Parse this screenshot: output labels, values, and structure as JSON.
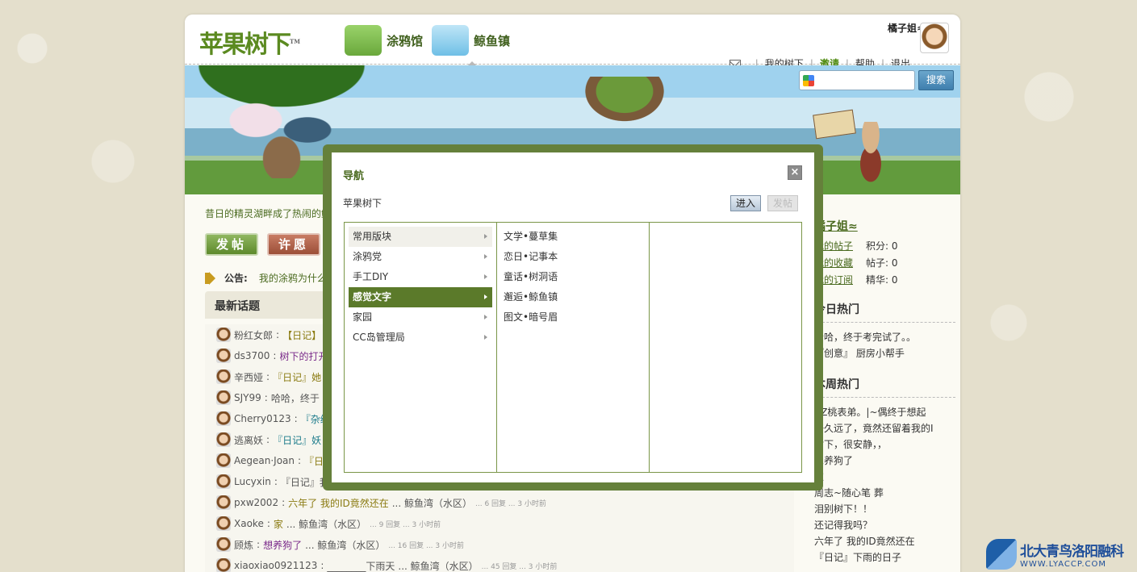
{
  "header": {
    "logo": "苹果树下",
    "logo_tm": "TM",
    "tabs": [
      {
        "label": "涂鸦馆"
      },
      {
        "label": "鲸鱼镇"
      }
    ],
    "username": "橘子姐≈",
    "links": {
      "my_tree": "我的树下",
      "invite": "邀请",
      "help": "帮助",
      "logout": "退出"
    }
  },
  "search": {
    "button": "搜索",
    "placeholder": ""
  },
  "main": {
    "marquee": "昔日的精灵湖畔成了热闹的鲸",
    "buttons": {
      "post": "发帖",
      "wish": "许愿"
    },
    "notice_label": "公告:",
    "notice_text": "我的涂鸦为什么",
    "latest_title": "最新话题",
    "topics": [
      {
        "user": "粉红女郎",
        "title": "【日记】",
        "style": "gold",
        "meta": "",
        "small": ""
      },
      {
        "user": "ds3700",
        "title": "树下的打开",
        "style": "purple",
        "meta": "",
        "small": ""
      },
      {
        "user": "辛西娅",
        "title": "『日记』她",
        "style": "gold",
        "meta": "",
        "small": ""
      },
      {
        "user": "SJY99",
        "title": "哈哈，终于",
        "style": "plain",
        "meta": "",
        "small": ""
      },
      {
        "user": "Cherry0123",
        "title": "『杂续",
        "style": "teal",
        "meta": "",
        "small": ""
      },
      {
        "user": "逃离妖",
        "title": "『日记』妖",
        "style": "teal",
        "meta": "",
        "small": ""
      },
      {
        "user": "Aegean·Joan",
        "title": "『日",
        "style": "gold",
        "meta": "",
        "small": ""
      },
      {
        "user": "Lucyxin",
        "title": "『日记』我",
        "style": "plain",
        "meta": "",
        "small": ""
      },
      {
        "user": "pxw2002",
        "title": "六年了 我的ID竟然还在",
        "style": "gold",
        "meta": "... 鲸鱼湾（水区）",
        "small": "... 6 回复 ... 3 小时前"
      },
      {
        "user": "Xaoke",
        "title": "家",
        "style": "gold",
        "meta": "... 鲸鱼湾（水区）",
        "small": "... 9 回复 ... 3 小时前"
      },
      {
        "user": "顾炼",
        "title": "想养狗了",
        "style": "purple",
        "meta": "... 鲸鱼湾（水区）",
        "small": "... 16 回复 ... 3 小时前"
      },
      {
        "user": "xiaoxiao0921123",
        "title": "________下雨天",
        "style": "plain",
        "meta": "... 鲸鱼湾（水区）",
        "small": "... 45 回复 ... 3 小时前"
      }
    ]
  },
  "sidebar": {
    "user": "橘子姐≈",
    "stats": [
      {
        "link": "我的帖子",
        "label": "积分: 0"
      },
      {
        "link": "我的收藏",
        "label": "帖子: 0"
      },
      {
        "link": "我的订阅",
        "label": "精华: 0"
      }
    ],
    "today_title": "今日热门",
    "today": [
      "哈哈，终于考完试了。。",
      "『创意』 厨房小帮手"
    ],
    "week_title": "本周热门",
    "week": [
      "AZ桃表弟。|~偶终于想起",
      "好久远了，竟然还留着我的I",
      "树下，很安静，，",
      "想养狗了",
      "家",
      "周志~随心笔 葬",
      "泪别树下！！",
      "还记得我吗？",
      "六年了 我的ID竟然还在",
      "『日记』下雨的日子"
    ]
  },
  "modal": {
    "title": "导航",
    "close": "×",
    "breadcrumb": "苹果树下",
    "enter": "进入",
    "post": "发帖",
    "categories": [
      {
        "label": "常用版块"
      },
      {
        "label": "涂鸦党"
      },
      {
        "label": "手工DIY"
      },
      {
        "label": "感觉文字"
      },
      {
        "label": "家园"
      },
      {
        "label": "CC岛管理局"
      }
    ],
    "subforums": [
      "文学•蔓草集",
      "恋日•记事本",
      "童话•树洞语",
      "邂逅•鲸鱼镇",
      "图文•暗号眉"
    ]
  },
  "watermark": {
    "name": "北大青鸟洛阳融科",
    "url": "WWW.LYACCP.COM"
  }
}
